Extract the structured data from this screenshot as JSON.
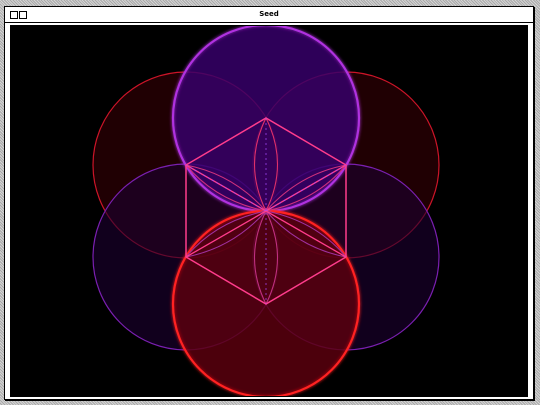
{
  "window": {
    "title": "Seed",
    "close_button_icon": "square-box-icon",
    "zoom_button_icon": "square-box-icon"
  },
  "colors": {
    "canvas_background": "#000000",
    "red_stroke": "#ff2a2a",
    "purple_stroke": "#a62bd6",
    "hexagon_stroke": "#ff3c8c"
  }
}
